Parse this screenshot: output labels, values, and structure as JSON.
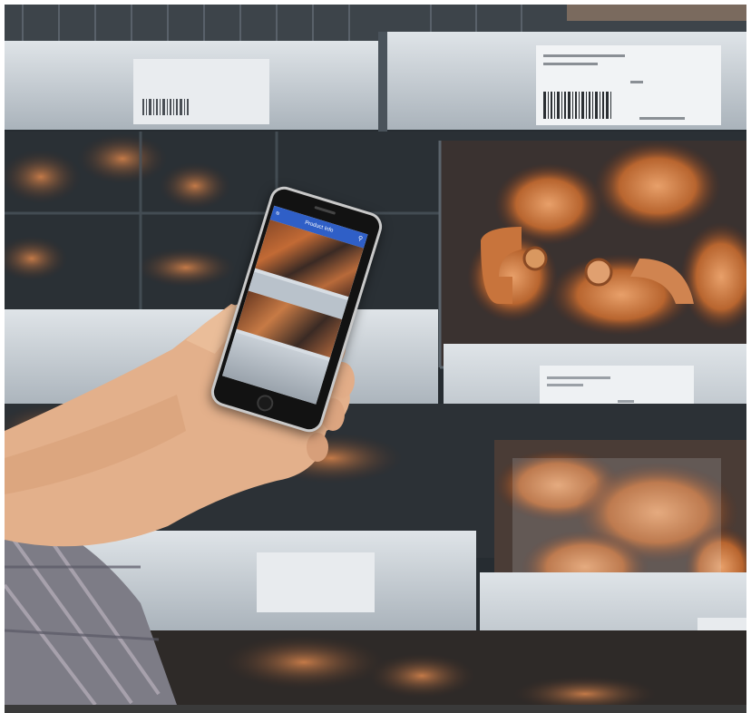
{
  "scene": {
    "subject": "hand-holding-phone-scanning-shelf-label",
    "colors": {
      "shelf_rail": "#c9d0d6",
      "label": "#e7eaed",
      "copper": "#c8743c",
      "bin_dark": "#2b3035",
      "skin": "#e2b08c",
      "phone_screen_header": "#2f5fc7"
    }
  },
  "phone_app": {
    "header_title": "Product Info"
  }
}
